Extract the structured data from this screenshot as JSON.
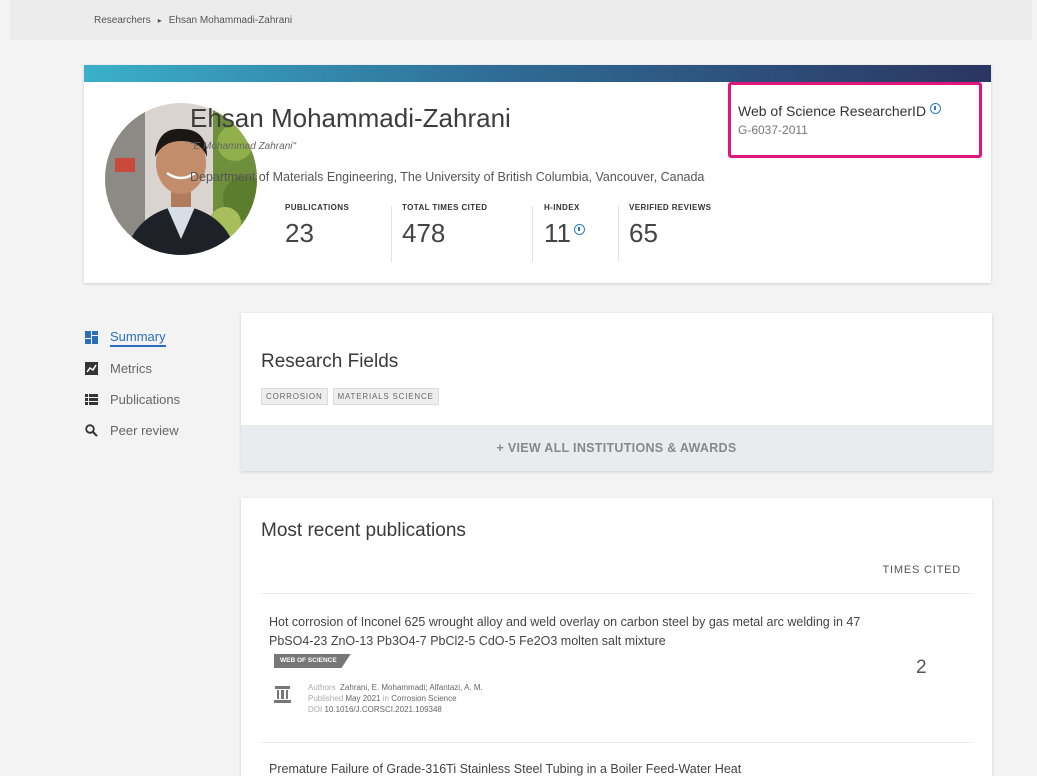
{
  "breadcrumb": {
    "root": "Researchers",
    "current": "Ehsan Mohammadi-Zahrani"
  },
  "profile": {
    "name": "Ehsan Mohammadi-Zahrani",
    "alias": "\"E Mohammad Zahrani\"",
    "affiliation": "Department of Materials Engineering, The University of British Columbia, Vancouver, Canada",
    "banner_colors": [
      "#3bb0c9",
      "#2f6d96",
      "#2b3561"
    ],
    "stats": [
      {
        "label": "PUBLICATIONS",
        "value": "23"
      },
      {
        "label": "TOTAL TIMES CITED",
        "value": "478"
      },
      {
        "label": "H-INDEX",
        "value": "11"
      },
      {
        "label": "VERIFIED REVIEWS",
        "value": "65"
      }
    ],
    "researcher_id": {
      "title": "Web of Science ResearcherID",
      "value": "G-6037-2011",
      "highlight_color": "#e0167e"
    }
  },
  "nav": {
    "items": [
      {
        "label": "Summary",
        "icon": "dashboard-icon",
        "active": true
      },
      {
        "label": "Metrics",
        "icon": "chart-icon",
        "active": false
      },
      {
        "label": "Publications",
        "icon": "list-icon",
        "active": false
      },
      {
        "label": "Peer review",
        "icon": "search-icon",
        "active": false
      }
    ],
    "accent_color": "#2a6ebb"
  },
  "research_fields": {
    "title": "Research Fields",
    "tags": [
      "CORROSION",
      "MATERIALS SCIENCE"
    ],
    "view_all": "+ VIEW ALL INSTITUTIONS & AWARDS"
  },
  "publications": {
    "title": "Most recent publications",
    "times_cited_header": "TIMES CITED",
    "items": [
      {
        "title": "Hot corrosion of Inconel 625 wrought alloy and weld overlay on carbon steel by gas metal arc welding in 47 PbSO4-23 ZnO-13 Pb3O4-7 PbCl2-5 CdO-5 Fe2O3 molten salt mixture",
        "badge": "WEB OF SCIENCE",
        "authors_label": "Authors",
        "authors": "Zahrani, E. Mohammadi; Alfantazi, A. M.",
        "published_label": "Published",
        "published": "May 2021",
        "in_label": "in",
        "journal": "Corrosion Science",
        "doi_label": "DOI",
        "doi": "10.1016/J.CORSCI.2021.109348",
        "times_cited": "2"
      },
      {
        "title": "Premature Failure of Grade-316Ti Stainless Steel Tubing in a Boiler Feed-Water Heat"
      }
    ]
  }
}
